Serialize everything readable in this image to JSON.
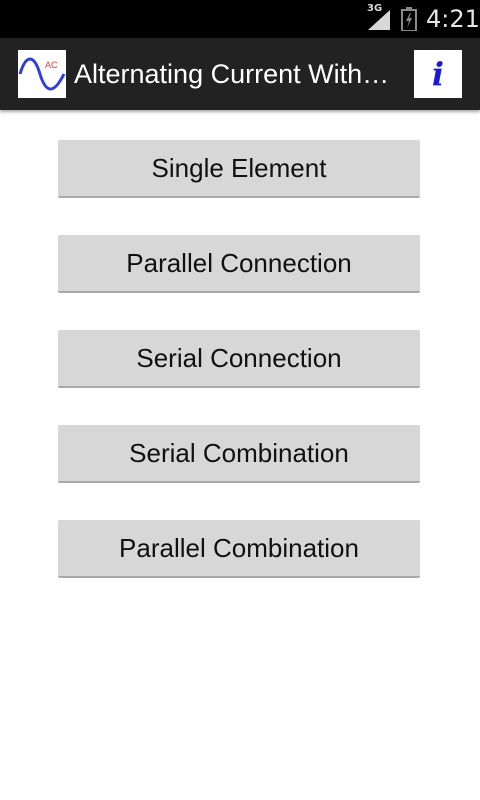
{
  "status_bar": {
    "network": "3G",
    "time": "4:21",
    "icons": [
      "signal-icon",
      "battery-icon"
    ]
  },
  "action_bar": {
    "title": "Alternating Current With…",
    "app_icon_text": "AC",
    "info_glyph": "i"
  },
  "menu": {
    "items": [
      {
        "label": "Single Element"
      },
      {
        "label": "Parallel Connection"
      },
      {
        "label": "Serial Connection"
      },
      {
        "label": "Serial Combination"
      },
      {
        "label": "Parallel Combination"
      }
    ]
  },
  "colors": {
    "status_bar_bg": "#000000",
    "action_bar_bg": "#222222",
    "button_bg": "#d7d7d7",
    "info_accent": "#1a1ad6",
    "wave_blue": "#2f3ed8",
    "app_icon_text": "#e8353a"
  }
}
